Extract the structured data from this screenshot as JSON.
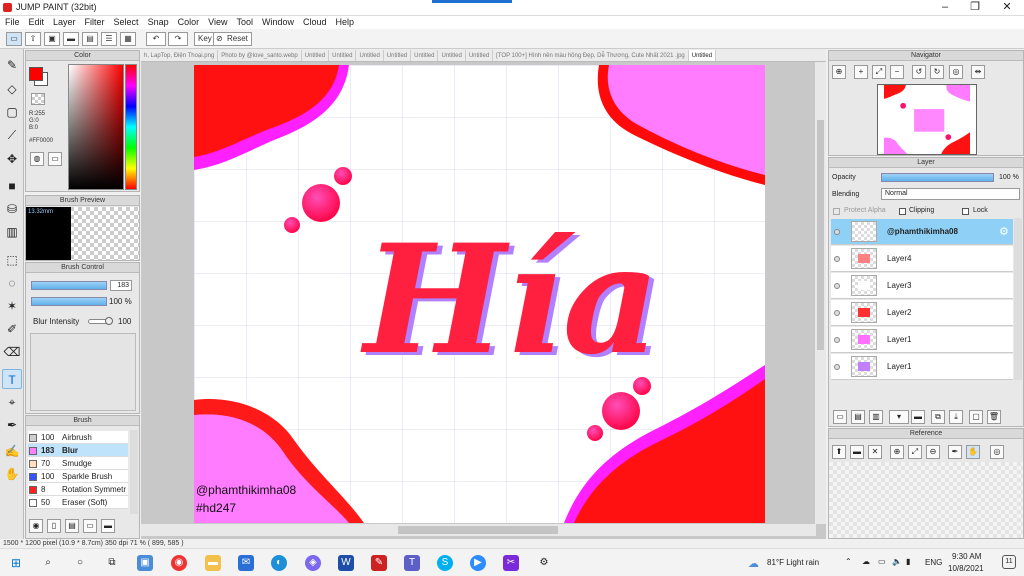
{
  "app": {
    "title": "JUMP PAINT (32bit)"
  },
  "menu": [
    "File",
    "Edit",
    "Layer",
    "Filter",
    "Select",
    "Snap",
    "Color",
    "View",
    "Tool",
    "Window",
    "Cloud",
    "Help"
  ],
  "toolbar": {
    "key_label": "Key",
    "reset_label": "Reset"
  },
  "tabs": [
    "h, LapTop, Điện Thoại.png",
    "Photo by @love_santo.webp",
    "Untitled",
    "Untitled",
    "Untitled",
    "Untitled",
    "Untitled",
    "Untitled",
    "Untitled",
    "[TOP 100+] Hình nền màu hồng Đẹp, Dễ Thương, Cute Nhất 2021 .jpg",
    "Untitled"
  ],
  "color_panel": {
    "title": "Color",
    "r": "R:255",
    "g": "G:0",
    "b": "B:0",
    "hex": "#FF0000",
    "current": "#ff0000"
  },
  "brush_preview": {
    "title": "Brush Preview",
    "size": "13.32mm"
  },
  "brush_control": {
    "title": "Brush Control",
    "size": "183",
    "opacity": "100 %",
    "blur_label": "Blur Intensity",
    "blur_value": "100"
  },
  "brush_list": {
    "title": "Brush",
    "items": [
      {
        "size": "100",
        "name": "Airbrush",
        "color": "#cfcfcf"
      },
      {
        "size": "183",
        "name": "Blur",
        "color": "#ff80ff"
      },
      {
        "size": "70",
        "name": "Smudge",
        "color": "#ffe0c0"
      },
      {
        "size": "100",
        "name": "Sparkle Brush",
        "color": "#3355ff"
      },
      {
        "size": "8",
        "name": "Rotation Symmetr",
        "color": "#ff2020"
      },
      {
        "size": "50",
        "name": "Eraser (Soft)",
        "color": "#ffffff"
      }
    ]
  },
  "canvas": {
    "title_text": "Hía",
    "watermark1": "@phamthikimha08",
    "watermark2": "#hd247"
  },
  "navigator": {
    "title": "Navigator"
  },
  "layer_panel": {
    "title": "Layer",
    "opacity_label": "Opacity",
    "opacity_value": "100 %",
    "blending_label": "Blending",
    "blending_value": "Normal",
    "protect_alpha": "Protect Alpha",
    "clipping": "Clipping",
    "lock": "Lock",
    "layers": [
      {
        "name": "@phamthikimha08"
      },
      {
        "name": "Layer4"
      },
      {
        "name": "Layer3"
      },
      {
        "name": "Layer2"
      },
      {
        "name": "Layer1"
      },
      {
        "name": "Layer1"
      }
    ]
  },
  "reference": {
    "title": "Reference"
  },
  "status": {
    "text": "1500 * 1200 pixel  (10.9 * 8.7cm)  350 dpi  71 %  ( 899, 585 )"
  },
  "taskbar": {
    "weather": "81°F  Light rain",
    "lang": "ENG",
    "time": "9:30 AM",
    "date": "10/8/2021",
    "notif": "11"
  }
}
